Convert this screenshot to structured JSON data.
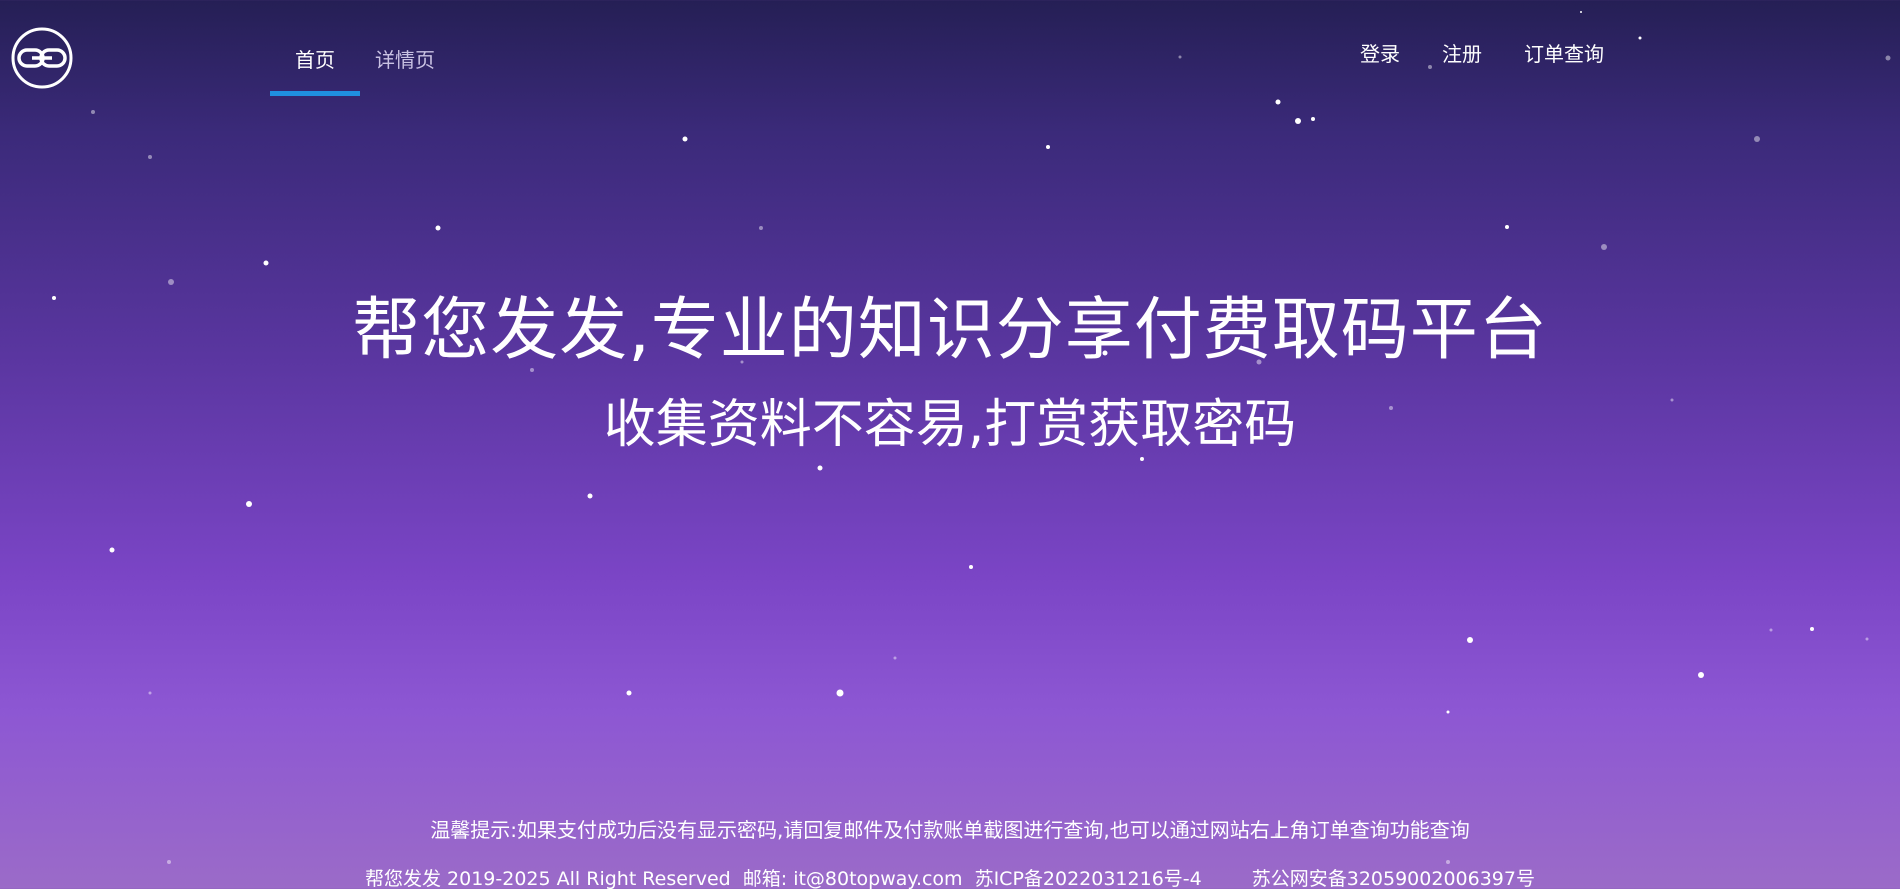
{
  "header": {
    "logo_icon": "chain-link-icon",
    "nav": [
      {
        "label": "首页",
        "active": true
      },
      {
        "label": "详情页",
        "active": false
      }
    ],
    "right_links": {
      "login": "登录",
      "register": "注册",
      "order_query": "订单查询"
    }
  },
  "hero": {
    "title": "帮您发发,专业的知识分享付费取码平台",
    "subtitle": "收集资料不容易,打赏获取密码"
  },
  "footer": {
    "tip": "温馨提示:如果支付成功后没有显示密码,请回复邮件及付款账单截图进行查询,也可以通过网站右上角订单查询功能查询",
    "copyright": "帮您发发 2019-2025 All Right Reserved",
    "email": "邮箱: it@80topway.com",
    "icp": "苏ICP备2022031216号-4",
    "police": "苏公网安备32059002006397号"
  },
  "colors": {
    "accent_underline": "#1f8fe0",
    "background_top": "#251f55",
    "background_bottom": "#9b6bc8"
  }
}
